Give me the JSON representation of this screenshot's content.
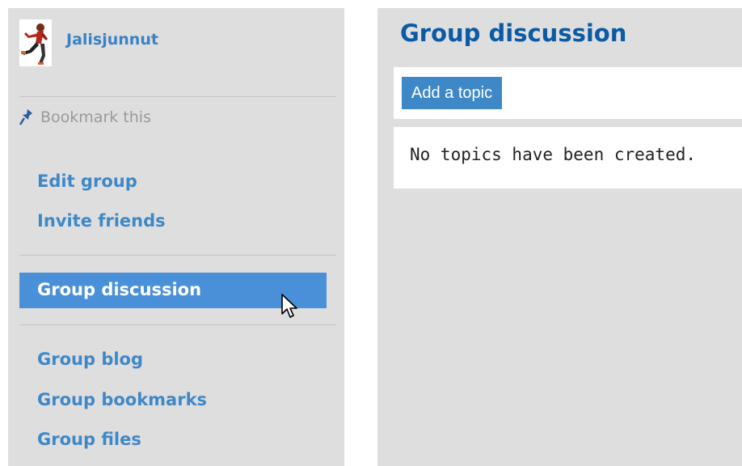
{
  "sidebar": {
    "group_name": "Jalisjunnut",
    "avatar_icon": "runner-avatar",
    "bookmark_label": "Bookmark this",
    "bookmark_icon": "pushpin-icon",
    "admin_links": [
      "Edit group",
      "Invite friends"
    ],
    "active_link": "Group discussion",
    "content_links": [
      "Group blog",
      "Group bookmarks",
      "Group files"
    ]
  },
  "main": {
    "title": "Group discussion",
    "add_topic_label": "Add a topic",
    "empty_message": "No topics have been created."
  },
  "colors": {
    "link": "#3f88c8",
    "title": "#0a5aa5",
    "active_bg": "#4a90d9",
    "panel_bg": "#dedede"
  }
}
